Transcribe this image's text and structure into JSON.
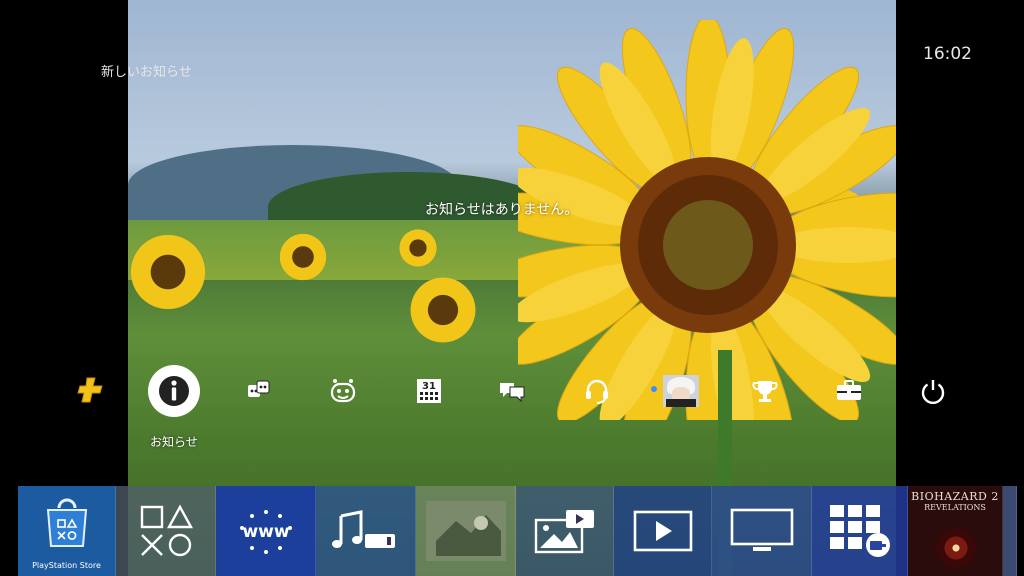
{
  "header": {
    "notifications_title": "新しいお知らせ",
    "time": "16:02"
  },
  "main": {
    "message": "お知らせはありません。"
  },
  "function_area": {
    "selected_label": "お知らせ",
    "items": [
      {
        "icon": "playstation-plus-icon",
        "color": "#f2c21b"
      },
      {
        "icon": "notifications-icon",
        "selected": true
      },
      {
        "icon": "friends-icon"
      },
      {
        "icon": "party-icon"
      },
      {
        "icon": "events-calendar-icon",
        "number": "31"
      },
      {
        "icon": "messages-icon"
      },
      {
        "icon": "party-headset-icon"
      },
      {
        "icon": "profile-avatar",
        "online_dot_color": "#3c8cff"
      },
      {
        "icon": "trophies-icon"
      },
      {
        "icon": "settings-toolbox-icon"
      },
      {
        "icon": "power-icon"
      }
    ]
  },
  "content_shelf": {
    "tiles": [
      {
        "id": "playstation-store",
        "label": "PlayStation Store"
      },
      {
        "id": "library",
        "icon": "library-shapes-icon"
      },
      {
        "id": "internet-browser",
        "icon": "www-icon",
        "text": "www"
      },
      {
        "id": "music",
        "icon": "music-icon"
      },
      {
        "id": "capture-gallery",
        "icon": "capture-thumbnail"
      },
      {
        "id": "media-gallery",
        "icon": "gallery-icon"
      },
      {
        "id": "video",
        "icon": "video-icon"
      },
      {
        "id": "tv-video",
        "icon": "tv-icon"
      },
      {
        "id": "applications",
        "icon": "apps-grid-icon"
      },
      {
        "id": "game",
        "title": "BIOHAZARD 2",
        "subtitle": "REVELATIONS"
      }
    ]
  }
}
